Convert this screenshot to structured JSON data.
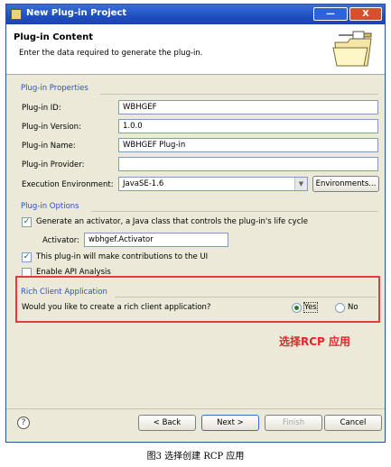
{
  "window": {
    "title": "New Plug-in Project",
    "min_label": "—",
    "close_label": "X"
  },
  "header": {
    "title": "Plug-in Content",
    "description": "Enter the data required to generate the plug-in."
  },
  "properties": {
    "group_title": "Plug-in Properties",
    "id_label": "Plug-in ID:",
    "id_value": "WBHGEF",
    "version_label": "Plug-in Version:",
    "version_value": "1.0.0",
    "name_label": "Plug-in Name:",
    "name_value": "WBHGEF Plug-in",
    "provider_label": "Plug-in Provider:",
    "provider_value": "",
    "env_label": "Execution Environment:",
    "env_value": "JavaSE-1.6",
    "env_button": "Environments..."
  },
  "options": {
    "group_title": "Plug-in Options",
    "activator_check_label": "Generate an activator, a Java class that controls the plug-in's life cycle",
    "activator_check_mark": "✓",
    "activator_label": "Activator:",
    "activator_value": "wbhgef.Activator",
    "ui_check_label": "This plug-in will make contributions to the UI",
    "ui_check_mark": "✓",
    "api_check_label": "Enable API Analysis"
  },
  "rcp": {
    "group_title": "Rich Client Application",
    "question": "Would you like to create a rich client application?",
    "yes_label": "Yes",
    "no_label": "No",
    "selected": "Yes"
  },
  "annotation": "选择RCP 应用",
  "footer": {
    "help_label": "?",
    "back_label": "< Back",
    "next_label": "Next >",
    "finish_label": "Finish",
    "cancel_label": "Cancel"
  },
  "caption": "图3 选择创建 RCP 应用",
  "colors": {
    "accent": "#2a52be",
    "highlight_box": "#e53a3a",
    "annotation": "#e0262a"
  }
}
